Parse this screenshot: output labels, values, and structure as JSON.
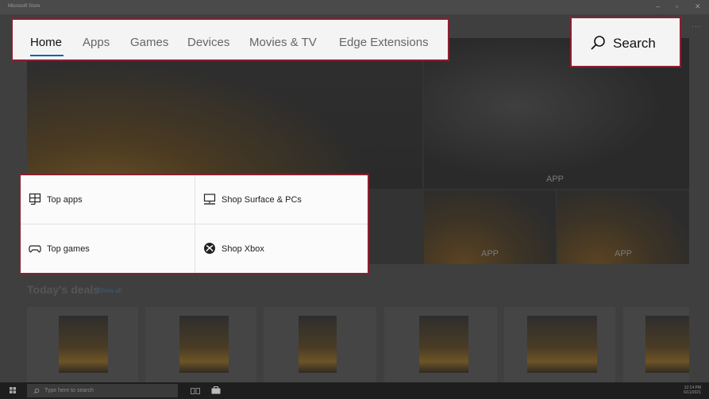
{
  "window": {
    "title": "Microsoft Store",
    "more_glyph": "···"
  },
  "nav": {
    "items": [
      {
        "label": "Home",
        "active": true
      },
      {
        "label": "Apps"
      },
      {
        "label": "Games"
      },
      {
        "label": "Devices"
      },
      {
        "label": "Movies & TV"
      },
      {
        "label": "Edge Extensions"
      }
    ]
  },
  "search": {
    "label": "Search",
    "icon": "search-icon"
  },
  "hero": {
    "tiles": [
      "APP",
      "APP",
      "APP"
    ]
  },
  "quick_links": [
    {
      "label": "Top apps",
      "icon": "apps-grid-icon"
    },
    {
      "label": "Shop Surface & PCs",
      "icon": "monitor-icon"
    },
    {
      "label": "Top games",
      "icon": "gamepad-icon"
    },
    {
      "label": "Shop Xbox",
      "icon": "xbox-logo-icon"
    }
  ],
  "deals": {
    "title": "Today's deals",
    "show_all": "Show all"
  },
  "taskbar": {
    "search_placeholder": "Type here to search",
    "time": "12:14 PM",
    "date": "6/11/2021"
  },
  "colors": {
    "highlight_border": "#8a2030",
    "accent": "#0063b1"
  }
}
